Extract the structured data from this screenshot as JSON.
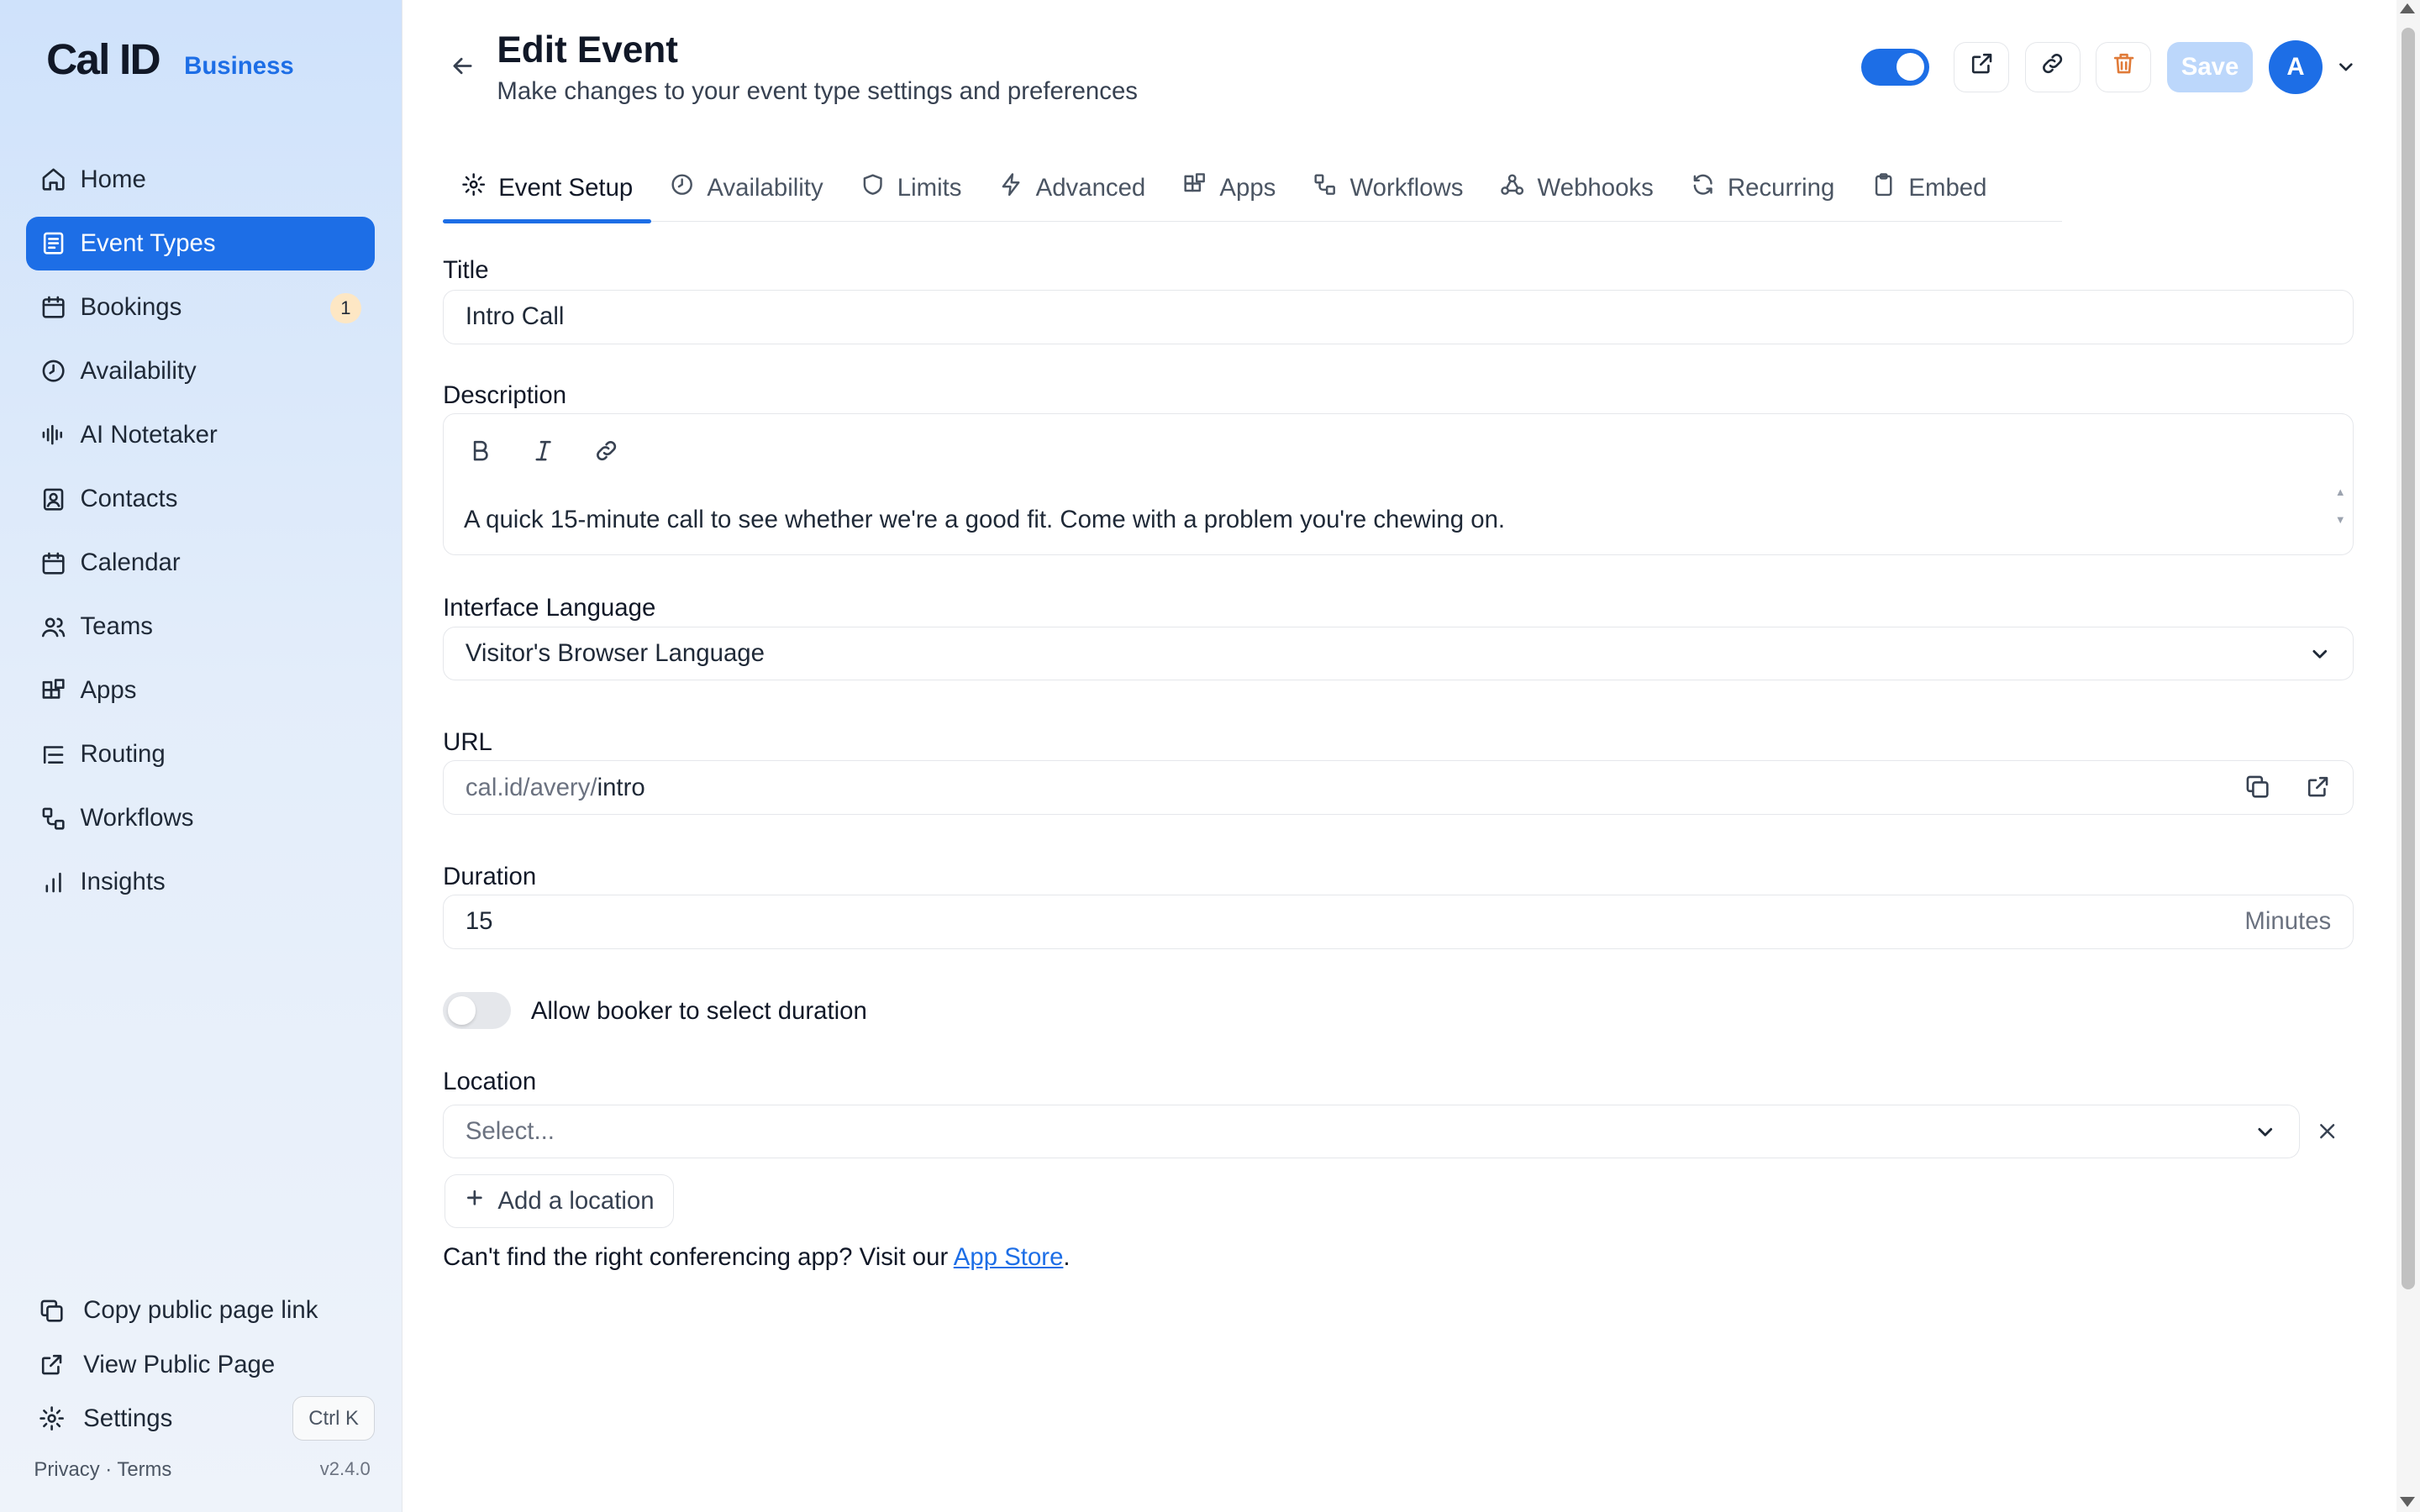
{
  "brand": {
    "logo": "Cal ID",
    "tag": "Business"
  },
  "sidebar": {
    "items": [
      {
        "label": "Home",
        "icon": "home-icon"
      },
      {
        "label": "Event Types",
        "icon": "event-types-icon",
        "active": true
      },
      {
        "label": "Bookings",
        "icon": "calendar-icon",
        "badge": "1"
      },
      {
        "label": "Availability",
        "icon": "clock-icon"
      },
      {
        "label": "AI Notetaker",
        "icon": "waveform-icon"
      },
      {
        "label": "Contacts",
        "icon": "contacts-icon"
      },
      {
        "label": "Calendar",
        "icon": "calendar-icon"
      },
      {
        "label": "Teams",
        "icon": "users-icon"
      },
      {
        "label": "Apps",
        "icon": "apps-icon"
      },
      {
        "label": "Routing",
        "icon": "routing-icon"
      },
      {
        "label": "Workflows",
        "icon": "workflows-icon"
      },
      {
        "label": "Insights",
        "icon": "bar-chart-icon"
      }
    ],
    "bottom": {
      "copy_link": "Copy public page link",
      "view_public": "View Public Page",
      "settings": "Settings",
      "shortcut": "Ctrl K"
    },
    "footer": {
      "links": "Privacy · Terms",
      "version": "v2.4.0"
    }
  },
  "header": {
    "title": "Edit Event",
    "subtitle": "Make changes to your event type settings and preferences",
    "save_label": "Save",
    "avatar_initial": "A"
  },
  "tabs": [
    {
      "label": "Event Setup",
      "icon": "gear-icon",
      "active": true
    },
    {
      "label": "Availability",
      "icon": "clock-icon"
    },
    {
      "label": "Limits",
      "icon": "shield-icon"
    },
    {
      "label": "Advanced",
      "icon": "lightning-icon"
    },
    {
      "label": "Apps",
      "icon": "apps-icon"
    },
    {
      "label": "Workflows",
      "icon": "workflows-icon"
    },
    {
      "label": "Webhooks",
      "icon": "webhook-icon"
    },
    {
      "label": "Recurring",
      "icon": "refresh-icon"
    },
    {
      "label": "Embed",
      "icon": "clipboard-icon"
    }
  ],
  "form": {
    "title_label": "Title",
    "title_value": "Intro Call",
    "description_label": "Description",
    "description_value": "A quick 15-minute call to see whether we're a good fit. Come with a problem you're chewing on.",
    "language_label": "Interface Language",
    "language_value": "Visitor's Browser Language",
    "url_label": "URL",
    "url_prefix": "cal.id/avery/",
    "url_slug": "intro",
    "duration_label": "Duration",
    "duration_value": "15",
    "duration_unit": "Minutes",
    "allow_duration_label": "Allow booker to select duration",
    "location_label": "Location",
    "location_placeholder": "Select...",
    "add_location_label": "Add a location",
    "help_text": "Can't find the right conferencing app? Visit our ",
    "help_link": "App Store",
    "help_end": "."
  },
  "colors": {
    "accent": "#1d6ee6",
    "badge": "#fde7c4",
    "delete": "#e07b39"
  }
}
